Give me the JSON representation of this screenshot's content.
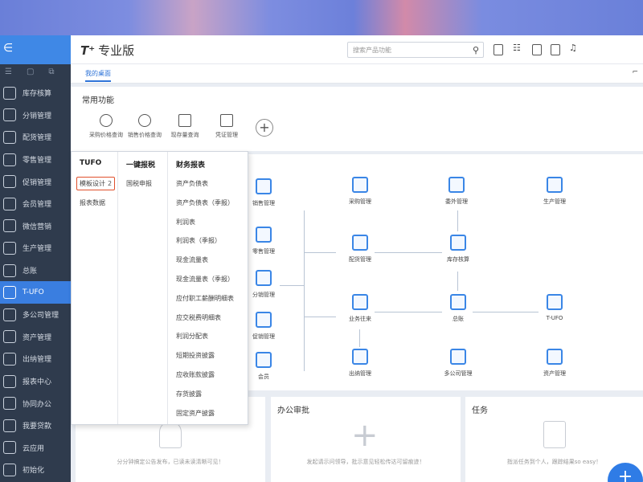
{
  "app": {
    "logo_mark": "T⁺",
    "title": "专业版"
  },
  "header": {
    "search_placeholder": "搜索产品功能"
  },
  "sidebar": {
    "items": [
      {
        "label": "库存核算",
        "icon": "inventory-icon"
      },
      {
        "label": "分销管理",
        "icon": "distribution-icon"
      },
      {
        "label": "配货管理",
        "icon": "allocation-icon"
      },
      {
        "label": "零售管理",
        "icon": "retail-icon"
      },
      {
        "label": "促销管理",
        "icon": "promotion-icon"
      },
      {
        "label": "会员管理",
        "icon": "member-icon"
      },
      {
        "label": "微信营销",
        "icon": "wechat-icon"
      },
      {
        "label": "生产管理",
        "icon": "production-icon"
      },
      {
        "label": "总账",
        "icon": "ledger-icon"
      },
      {
        "label": "T-UFO",
        "icon": "tufo-icon"
      },
      {
        "label": "多公司管理",
        "icon": "multi-company-icon"
      },
      {
        "label": "资产管理",
        "icon": "asset-icon"
      },
      {
        "label": "出纳管理",
        "icon": "cashier-icon"
      },
      {
        "label": "报表中心",
        "icon": "report-icon"
      },
      {
        "label": "协同办公",
        "icon": "collab-icon"
      },
      {
        "label": "我要贷款",
        "icon": "loan-icon"
      },
      {
        "label": "云应用",
        "icon": "cloud-icon"
      },
      {
        "label": "初始化",
        "icon": "init-icon"
      }
    ]
  },
  "tabs": [
    {
      "label": "我的桌面"
    }
  ],
  "common": {
    "title": "常用功能",
    "items": [
      {
        "label": "采购价格查询"
      },
      {
        "label": "销售价格查询"
      },
      {
        "label": "现存量查询"
      },
      {
        "label": "凭证管理"
      }
    ]
  },
  "flow": {
    "nodes": {
      "sales": "销售管理",
      "retail": "零售管理",
      "distribution": "分销管理",
      "promotion": "促销管理",
      "member": "会员",
      "purchase": "采购管理",
      "outsource": "委外管理",
      "production": "生产管理",
      "allocation": "配货管理",
      "inventory": "库存核算",
      "business": "业务往来",
      "ledger": "总账",
      "tufo": "T-UFO",
      "cashier": "出纳管理",
      "multi": "多公司管理",
      "asset": "资产管理"
    }
  },
  "cards": {
    "announce_msg": "分分钟搞定公告发布，已读未读清晰可见！",
    "approval_title": "办公审批",
    "approval_msg": "发起请示问领导，批示意见轻松传达可留痕迹！",
    "task_title": "任务",
    "task_msg": "指派任务到个人，跟踪结果so easy！"
  },
  "menu": {
    "col1": {
      "header": "TUFO",
      "items": [
        "模板设计",
        "报表数据"
      ],
      "badge": "2"
    },
    "col2": {
      "header": "一键报税",
      "items": [
        "国税申报"
      ]
    },
    "col3": {
      "header": "财务报表",
      "items": [
        "资产负债表",
        "资产负债表（季报）",
        "利润表",
        "利润表（季报）",
        "现金流量表",
        "现金流量表（季报）",
        "应付职工薪酬明细表",
        "应交税费明细表",
        "利润分配表",
        "短期投资披露",
        "应收账款披露",
        "存货披露",
        "固定资产披露"
      ]
    }
  },
  "fab": {
    "label": "+"
  }
}
